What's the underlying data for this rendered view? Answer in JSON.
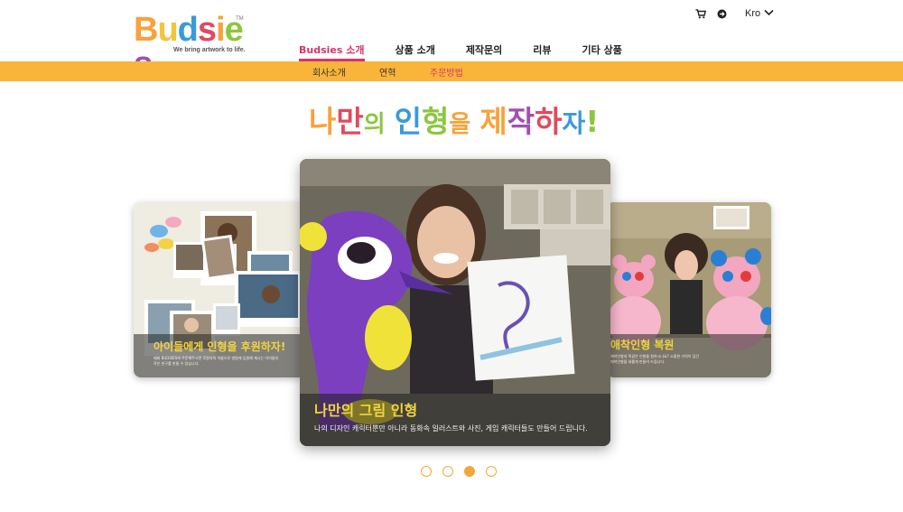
{
  "brand": {
    "logo_letters": [
      "B",
      "u",
      "d",
      "s",
      "i",
      "e",
      "s"
    ],
    "logo_colors": [
      "#f9a13a",
      "#f3c53a",
      "#3a9ad9",
      "#e04a5f",
      "#f9a13a",
      "#8cc63e",
      "#a24fb0"
    ],
    "trademark": "TM",
    "tagline": "We bring artwork to life."
  },
  "utility": {
    "cart_icon": "cart-icon",
    "signin_icon": "sign-in-icon",
    "language": "Kro",
    "language_icon": "chevron-down-icon"
  },
  "nav": {
    "items": [
      {
        "label": "Budsies 소개",
        "active": true
      },
      {
        "label": "상품 소개",
        "active": false
      },
      {
        "label": "제작문의",
        "active": false
      },
      {
        "label": "리뷰",
        "active": false
      },
      {
        "label": "기타 상품",
        "active": false
      }
    ]
  },
  "subnav": {
    "items": [
      {
        "label": "회사소개",
        "active": false
      },
      {
        "label": "연혁",
        "active": false
      },
      {
        "label": "주문방법",
        "active": true
      }
    ]
  },
  "headline": {
    "chars": [
      "나",
      "만",
      "의",
      " ",
      "인",
      "형",
      "을",
      " ",
      "제",
      "작",
      "하",
      "자",
      "!"
    ],
    "colors": [
      "#f9a13a",
      "#e04a5f",
      "#8cc63e",
      "#ffffff",
      "#3a9ad9",
      "#8cc63e",
      "#f9a13a",
      "#ffffff",
      "#f9a13a",
      "#a24fb0",
      "#e04a5f",
      "#3a9ad9",
      "#8cc63e"
    ]
  },
  "carousel": {
    "slides": [
      {
        "title": "아이들에게 인형을 후원하자!",
        "text_1": "매회 BUDSIES에 주문해주시면 후원자의 이름으로 병원에 입원해 계시는 아이들의",
        "text_2": "작은 친구를 만들 수 있습니다."
      },
      {
        "title": "나만의 그림 인형",
        "text_1": "나의 디자인 캐릭터뿐만 아니라 동화속 일러스트와 사진, 게임 캐릭터들도 만들어 드립니다."
      },
      {
        "title": "애착인형 복원",
        "text_1": "애착인형과 똑같은 인형을 원하시나요? 소중한 기억이 담긴",
        "text_2": "애착인형을 새롭게 만들어 드립니다."
      }
    ],
    "active_dot": 2,
    "dot_count": 4
  },
  "colors": {
    "accent_orange": "#f9b53a",
    "accent_pink": "#d6336c"
  }
}
